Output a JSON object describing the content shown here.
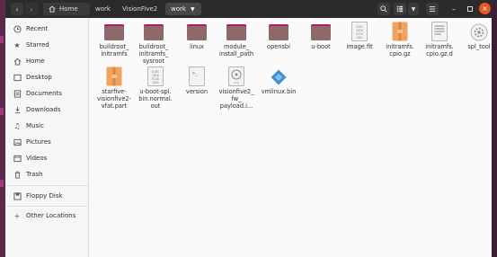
{
  "headerbar": {
    "back_icon": "chevron-left-icon",
    "forward_icon": "chevron-right-icon",
    "breadcrumbs": [
      "Home",
      "work",
      "VisionFive2",
      "work"
    ],
    "dropdown_icon": "chevron-down-icon",
    "search_icon": "search-icon",
    "view_icon": "list-view-icon",
    "sort_icon": "chevron-down-icon",
    "menu_icon": "hamburger-icon",
    "minimize_icon": "minimize-icon",
    "maximize_icon": "maximize-icon",
    "close_icon": "close-icon"
  },
  "sidebar": {
    "items": [
      {
        "label": "Recent",
        "icon": "clock-icon"
      },
      {
        "label": "Starred",
        "icon": "star-icon"
      },
      {
        "label": "Home",
        "icon": "home-icon"
      },
      {
        "label": "Desktop",
        "icon": "desktop-icon"
      },
      {
        "label": "Documents",
        "icon": "document-icon"
      },
      {
        "label": "Downloads",
        "icon": "download-icon"
      },
      {
        "label": "Music",
        "icon": "music-icon"
      },
      {
        "label": "Pictures",
        "icon": "picture-icon"
      },
      {
        "label": "Videos",
        "icon": "video-icon"
      },
      {
        "label": "Trash",
        "icon": "trash-icon"
      },
      {
        "label": "Floppy Disk",
        "icon": "floppy-icon"
      },
      {
        "label": "Other Locations",
        "icon": "plus-icon"
      }
    ]
  },
  "files": [
    {
      "name": "buildroot_\ninitramfs",
      "type": "folder"
    },
    {
      "name": "buildroot_\ninitramfs_\nsysroot",
      "type": "folder"
    },
    {
      "name": "linux",
      "type": "folder"
    },
    {
      "name": "module_\ninstall_path",
      "type": "folder"
    },
    {
      "name": "opensbi",
      "type": "folder"
    },
    {
      "name": "u-boot",
      "type": "folder"
    },
    {
      "name": "image.fit",
      "type": "binary"
    },
    {
      "name": "initramfs.\ncpio.gz",
      "type": "archive"
    },
    {
      "name": "initramfs.\ncpio.gz.d",
      "type": "text"
    },
    {
      "name": "spl_tool",
      "type": "gear"
    },
    {
      "name": "starfive-\nvisionfive2-\nvfat.part",
      "type": "archive"
    },
    {
      "name": "u-boot-spl.\nbin.normal.\nout",
      "type": "binary"
    },
    {
      "name": "version",
      "type": "script"
    },
    {
      "name": "visionfive2_\nfw_\npayload.i...",
      "type": "disk"
    },
    {
      "name": "vmlinux.bin",
      "type": "diamond"
    }
  ],
  "colors": {
    "folder_body": "#8c6a6a",
    "folder_top": "#c2185b",
    "archive": "#f0a35e",
    "accent_close": "#e95420",
    "headerbar": "#2b2b2b"
  }
}
